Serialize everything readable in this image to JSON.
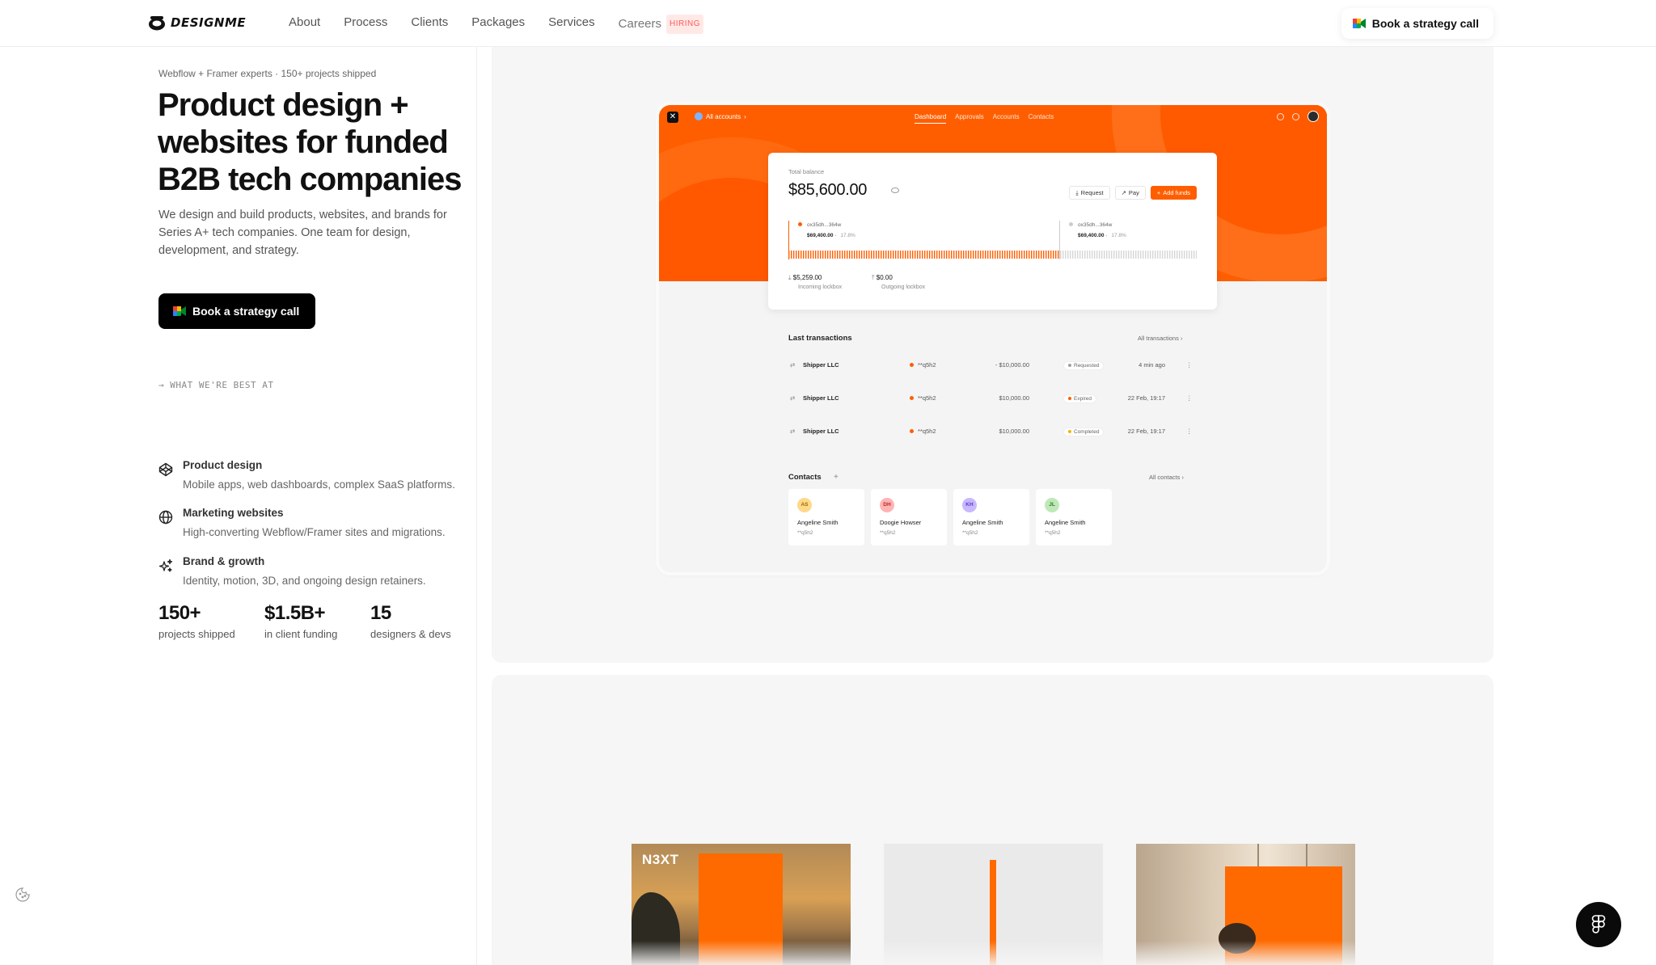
{
  "nav": {
    "logo_text": "DESIGNME",
    "links": [
      "About",
      "Process",
      "Clients",
      "Packages",
      "Services",
      "Careers"
    ],
    "hiring_badge": "HIRING",
    "cta_label": "Book a strategy call"
  },
  "hero": {
    "eyebrow": "Webflow + Framer experts · 150+ projects shipped",
    "title": "Product design + websites for funded B2B tech companies",
    "subtitle": "We design and build products, websites, and brands for Series A+ tech companies. One team for design, development, and strategy.",
    "cta_label": "Book a strategy call"
  },
  "best_at": {
    "label": "→ WHAT WE'RE BEST AT",
    "items": [
      {
        "title": "Product design",
        "desc": "Mobile apps, web dashboards, complex SaaS platforms.",
        "icon": "codepen-icon"
      },
      {
        "title": "Marketing websites",
        "desc": "High-converting Webflow/Framer sites and migrations.",
        "icon": "globe-icon"
      },
      {
        "title": "Brand & growth",
        "desc": "Identity, motion, 3D, and ongoing design retainers.",
        "icon": "sparkles-icon"
      }
    ]
  },
  "stats": [
    {
      "value": "150+",
      "label": "projects shipped"
    },
    {
      "value": "$1.5B+",
      "label": "in client funding"
    },
    {
      "value": "15",
      "label": "designers & devs"
    }
  ],
  "dashboard": {
    "account_selector": "All accounts",
    "tabs": [
      "Dashboard",
      "Approvals",
      "Accounts",
      "Contacts"
    ],
    "active_tab": "Dashboard",
    "balance_label": "Total balance",
    "balance_amount": "$85,600.00",
    "buttons": {
      "request": "Request",
      "pay": "Pay",
      "add_funds": "Add funds"
    },
    "accounts": [
      {
        "id": "ox35dh...364w",
        "amount": "$69,400.00",
        "pct": "17.8%",
        "color": "#ff5e00"
      },
      {
        "id": "ox35dh...364w",
        "amount": "$69,400.00",
        "pct": "17.8%",
        "color": "#cccccc"
      }
    ],
    "lockboxes": [
      {
        "amount": "$5,259.00",
        "label": "Incoming lockbox"
      },
      {
        "amount": "$0.00",
        "label": "Outgoing lockbox"
      }
    ],
    "transactions_title": "Last transactions",
    "transactions_all": "All transactions",
    "transactions": [
      {
        "name": "Shipper LLC",
        "code": "**q5h2",
        "amount": "- $10,000.00",
        "status": "Requested",
        "status_color": "#9aa0a6",
        "time": "4 min ago"
      },
      {
        "name": "Shipper LLC",
        "code": "**q5h2",
        "amount": "$10,000.00",
        "status": "Expired",
        "status_color": "#ff5e00",
        "time": "22 Feb, 19:17"
      },
      {
        "name": "Shipper LLC",
        "code": "**q5h2",
        "amount": "$10,000.00",
        "status": "Completed",
        "status_color": "#f5b400",
        "time": "22 Feb, 19:17"
      }
    ],
    "contacts_title": "Contacts",
    "contacts_all": "All contacts",
    "contacts": [
      {
        "initials": "AS",
        "name": "Angeline Smith",
        "code": "**q5h2",
        "bg": "#ffd98a",
        "fg": "#9a6b00"
      },
      {
        "initials": "DH",
        "name": "Doogie Howser",
        "code": "**q5h2",
        "bg": "#ffb3b3",
        "fg": "#b02a2a"
      },
      {
        "initials": "KH",
        "name": "Angeline Smith",
        "code": "**q5h2",
        "bg": "#c8b8ff",
        "fg": "#5b3fbf"
      },
      {
        "initials": "JL",
        "name": "Angeline Smith",
        "code": "**q5h2",
        "bg": "#bfe8b8",
        "fg": "#2f7a26"
      }
    ]
  },
  "thumbnails": [
    {
      "brand_text": "N3XT"
    },
    {
      "brand_text": ""
    },
    {
      "brand_text": ""
    }
  ],
  "colors": {
    "accent": "#ff5e00",
    "dark": "#000000"
  }
}
